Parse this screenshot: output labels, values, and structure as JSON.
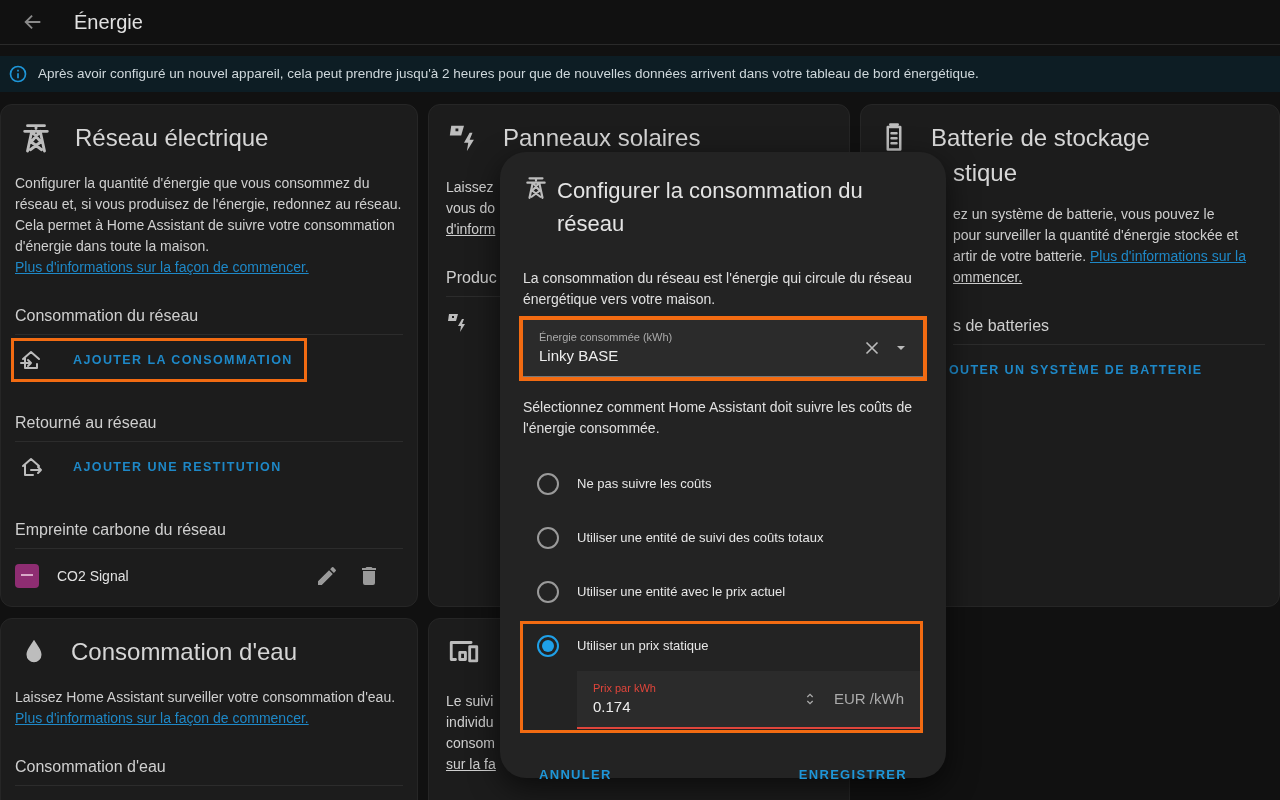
{
  "header": {
    "title": "Énergie"
  },
  "alert": {
    "text": "Après avoir configuré un nouvel appareil, cela peut prendre jusqu'à 2 heures pour que de nouvelles données arrivent dans votre tableau de bord énergétique."
  },
  "cards": [
    {
      "kind": "full",
      "title": "Réseau électrique",
      "description": "Configurer la quantité d'énergie que vous consommez du réseau et, si vous produisez de l'énergie, redonnez au réseau. Cela permet à Home Assistant de suivre votre consommation d'énergie dans toute la maison.",
      "link": "Plus d'informations sur la façon de commencer.",
      "sections": [
        {
          "title": "Consommation du réseau",
          "items": [
            {
              "kind": "action",
              "label": "AJOUTER LA CONSOMMATION",
              "highlighted": true
            }
          ]
        },
        {
          "title": "Retourné au réseau",
          "items": [
            {
              "kind": "action",
              "label": "AJOUTER UNE RESTITUTION",
              "highlighted": false
            }
          ]
        },
        {
          "title": "Empreinte carbone du réseau",
          "items": [
            {
              "kind": "source",
              "name": "CO2 Signal"
            }
          ]
        }
      ]
    },
    {
      "kind": "partial",
      "title": [
        "Panneaux solaires"
      ],
      "lines": [
        {
          "text": "Laissez"
        },
        {
          "text": "vous do"
        },
        {
          "text": "d'inform",
          "link": true
        }
      ],
      "section": "Produc"
    },
    {
      "kind": "partial",
      "title": [
        "Batterie de stockage",
        "stique"
      ],
      "lines": [
        {
          "text": "ez un système de batterie, vous pouvez le"
        },
        {
          "text": "pour surveiller la quantité d'énergie stockée et"
        },
        {
          "text": "artir de votre batterie.",
          "link_text": "Plus d'informations sur la"
        },
        {
          "text": "ommencer.",
          "link": true
        }
      ],
      "section": "s de batteries",
      "action": "OUTER UN SYSTÈME DE BATTERIE"
    },
    {
      "kind": "full",
      "title": "Consommation d'eau",
      "description": "Laissez Home Assistant surveiller votre consommation d'eau.",
      "link": "Plus d'informations sur la façon de commencer.",
      "sections": [
        {
          "title": "Consommation d'eau"
        }
      ]
    },
    {
      "kind": "partial",
      "lines": [
        {
          "text": "Le suivi"
        },
        {
          "text": "individu"
        },
        {
          "text": "consom"
        },
        {
          "text": "sur la fa",
          "link": true
        }
      ]
    }
  ],
  "dialog": {
    "title": "Configurer la consommation du réseau",
    "description": "La consommation du réseau est l'énergie qui circule du réseau énergétique vers votre maison.",
    "entity_field": {
      "label": "Énergie consommée (kWh)",
      "value": "Linky BASE",
      "highlighted": true
    },
    "cost_prompt": "Sélectionnez comment Home Assistant doit suivre les coûts de l'énergie consommée.",
    "options": [
      {
        "label": "Ne pas suivre les coûts",
        "selected": false,
        "highlighted": false
      },
      {
        "label": "Utiliser une entité de suivi des coûts totaux",
        "selected": false,
        "highlighted": false
      },
      {
        "label": "Utiliser une entité avec le prix actuel",
        "selected": false,
        "highlighted": false
      },
      {
        "label": "Utiliser un prix statique",
        "selected": true,
        "highlighted": true,
        "price": {
          "label": "Prix par kWh",
          "value": "0.174",
          "unit": "EUR /kWh",
          "invalid": true
        }
      }
    ],
    "buttons": [
      {
        "label": "ANNULER"
      },
      {
        "label": "ENREGISTRER"
      }
    ]
  }
}
